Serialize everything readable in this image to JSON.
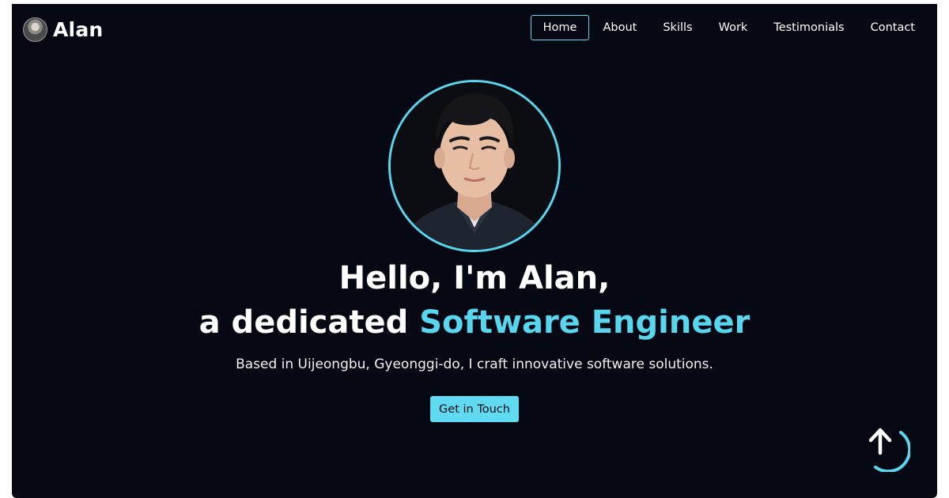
{
  "nav": {
    "brand": "Alan",
    "items": [
      {
        "label": "Home",
        "active": true
      },
      {
        "label": "About",
        "active": false
      },
      {
        "label": "Skills",
        "active": false
      },
      {
        "label": "Work",
        "active": false
      },
      {
        "label": "Testimonials",
        "active": false
      },
      {
        "label": "Contact",
        "active": false
      }
    ]
  },
  "hero": {
    "line1": "Hello, I'm Alan,",
    "line2_prefix": "a dedicated ",
    "line2_accent": "Software Engineer",
    "tagline": "Based in Uijeongbu, Gyeonggi-do, I craft innovative software solutions.",
    "cta": "Get in Touch"
  },
  "colors": {
    "background": "#060913",
    "accent": "#59d6ee",
    "text": "#ffffff"
  },
  "icons": {
    "scroll_top": "arrow-up-icon"
  }
}
